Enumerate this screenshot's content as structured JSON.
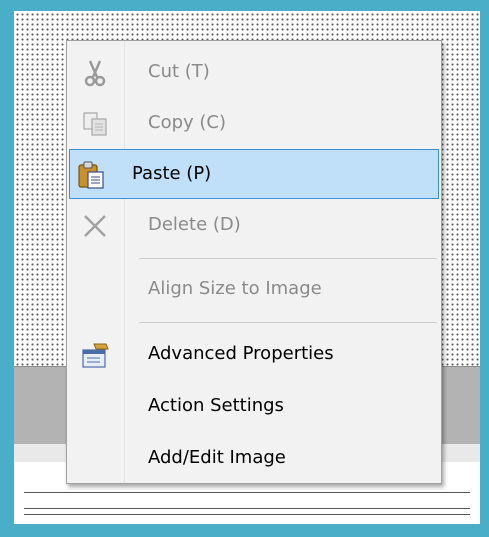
{
  "context_menu": {
    "items": [
      {
        "label": "Cut (T)",
        "icon": "scissors-icon",
        "enabled": false
      },
      {
        "label": "Copy (C)",
        "icon": "copy-icon",
        "enabled": false
      },
      {
        "label": "Paste (P)",
        "icon": "paste-icon",
        "enabled": true,
        "highlighted": true
      },
      {
        "label": "Delete (D)",
        "icon": "delete-x-icon",
        "enabled": false
      },
      {
        "label": "Align Size to Image",
        "enabled": false
      },
      {
        "label": "Advanced Properties",
        "icon": "properties-icon",
        "enabled": true
      },
      {
        "label": "Action Settings",
        "enabled": true
      },
      {
        "label": "Add/Edit Image",
        "enabled": true
      }
    ]
  },
  "colors": {
    "frame_border": "#4aaec9",
    "highlight_fill": "#bfe0f8",
    "highlight_border": "#3c8fd6",
    "disabled_text": "#8a8a8a"
  }
}
